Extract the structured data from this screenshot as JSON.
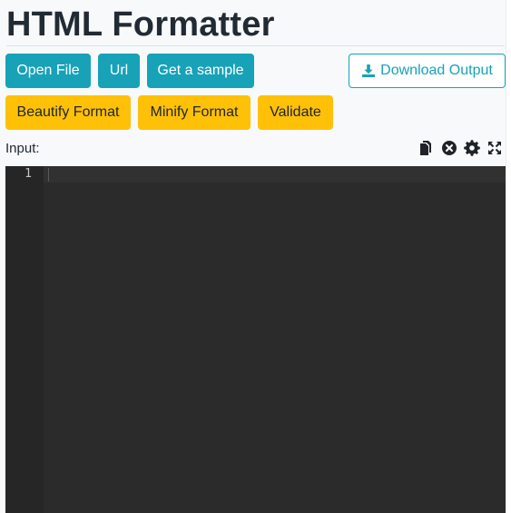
{
  "header": {
    "title": "HTML Formatter"
  },
  "toolbar": {
    "open_file_label": "Open File",
    "url_label": "Url",
    "get_sample_label": "Get a sample",
    "download_label": "Download Output",
    "download_icon": "download-icon",
    "beautify_label": "Beautify Format",
    "minify_label": "Minify Format",
    "validate_label": "Validate"
  },
  "input_panel": {
    "label": "Input:",
    "icons": [
      "copy-icon",
      "clear-icon",
      "settings-icon",
      "fullscreen-icon"
    ]
  },
  "editor": {
    "line_numbers": [
      "1"
    ],
    "content": ""
  },
  "colors": {
    "info": "#17a2b8",
    "warning": "#ffc107",
    "editor_background": "#2b2b2b",
    "gutter_background": "#262626"
  }
}
